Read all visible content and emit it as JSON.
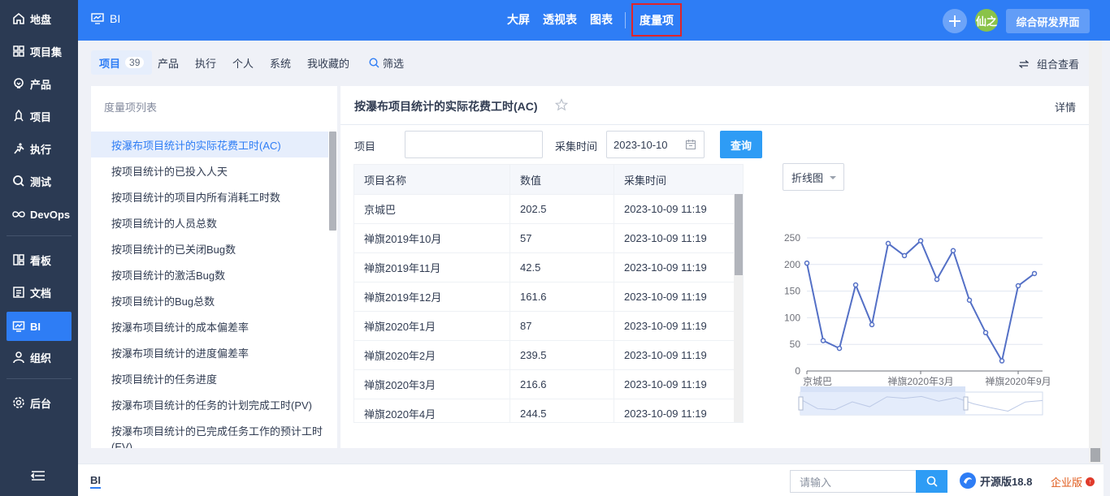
{
  "left_nav": {
    "items": [
      {
        "label": "地盘",
        "icon": "home-icon"
      },
      {
        "label": "项目集",
        "icon": "grid-icon"
      },
      {
        "label": "产品",
        "icon": "bulb-icon"
      },
      {
        "label": "项目",
        "icon": "project-icon"
      },
      {
        "label": "执行",
        "icon": "run-icon"
      },
      {
        "label": "测试",
        "icon": "test-icon"
      },
      {
        "label": "DevOps",
        "icon": "infinity-icon"
      },
      {
        "label": "看板",
        "icon": "board-icon"
      },
      {
        "label": "文档",
        "icon": "doc-icon"
      },
      {
        "label": "BI",
        "icon": "bi-icon"
      },
      {
        "label": "组织",
        "icon": "org-icon"
      },
      {
        "label": "后台",
        "icon": "gear-icon"
      }
    ],
    "active": "BI"
  },
  "header": {
    "module_title": "BI",
    "nav": [
      "大屏",
      "透视表",
      "图表"
    ],
    "active_nav": "度量项",
    "avatar_text": "仙之",
    "rd_button": "综合研发界面"
  },
  "tabs": {
    "items": [
      {
        "label": "项目",
        "count": "39"
      },
      {
        "label": "产品"
      },
      {
        "label": "执行"
      },
      {
        "label": "个人"
      },
      {
        "label": "系统"
      },
      {
        "label": "我收藏的"
      }
    ],
    "filter": "筛选",
    "combo_view": "组合查看"
  },
  "sidebar": {
    "title": "度量项列表",
    "items": [
      "按瀑布项目统计的实际花费工时(AC)",
      "按项目统计的已投入人天",
      "按项目统计的项目内所有消耗工时数",
      "按项目统计的人员总数",
      "按项目统计的已关闭Bug数",
      "按项目统计的激活Bug数",
      "按项目统计的Bug总数",
      "按瀑布项目统计的成本偏差率",
      "按瀑布项目统计的进度偏差率",
      "按项目统计的任务进度",
      "按瀑布项目统计的任务的计划完成工时(PV)",
      "按瀑布项目统计的已完成任务工作的预计工时(EV)"
    ]
  },
  "detail": {
    "title": "按瀑布项目统计的实际花费工时(AC)",
    "detail_link": "详情",
    "project_label": "项目",
    "project_value": "",
    "time_label": "采集时间",
    "date_value": "2023-10-10",
    "query_button": "查询"
  },
  "table": {
    "columns": [
      "项目名称",
      "数值",
      "采集时间"
    ],
    "rows": [
      [
        "京城巴",
        "202.5",
        "2023-10-09 11:19"
      ],
      [
        "禅旗2019年10月",
        "57",
        "2023-10-09 11:19"
      ],
      [
        "禅旗2019年11月",
        "42.5",
        "2023-10-09 11:19"
      ],
      [
        "禅旗2019年12月",
        "161.6",
        "2023-10-09 11:19"
      ],
      [
        "禅旗2020年1月",
        "87",
        "2023-10-09 11:19"
      ],
      [
        "禅旗2020年2月",
        "239.5",
        "2023-10-09 11:19"
      ],
      [
        "禅旗2020年3月",
        "216.6",
        "2023-10-09 11:19"
      ],
      [
        "禅旗2020年4月",
        "244.5",
        "2023-10-09 11:19"
      ]
    ]
  },
  "chart_select": "折线图",
  "chart_data": {
    "type": "line",
    "x_tick_labels": [
      "京城巴",
      "禅旗2020年3月",
      "禅旗2020年9月"
    ],
    "values": [
      202.5,
      57,
      42.5,
      161.6,
      87,
      239.5,
      216.6,
      244.5,
      172,
      226,
      133,
      72,
      19,
      160,
      183
    ],
    "y_ticks": [
      "0",
      "50",
      "100",
      "150",
      "200",
      "250"
    ],
    "ylim": [
      0,
      250
    ],
    "grid": true,
    "color": "#5470c6"
  },
  "footer": {
    "crumb": "BI",
    "search_placeholder": "请输入",
    "version": "开源版18.8",
    "enterprise": "企业版"
  },
  "colors": {
    "primary": "#2e7df5",
    "nav_bg": "#2b3a53",
    "highlight_border": "#e0242a"
  }
}
